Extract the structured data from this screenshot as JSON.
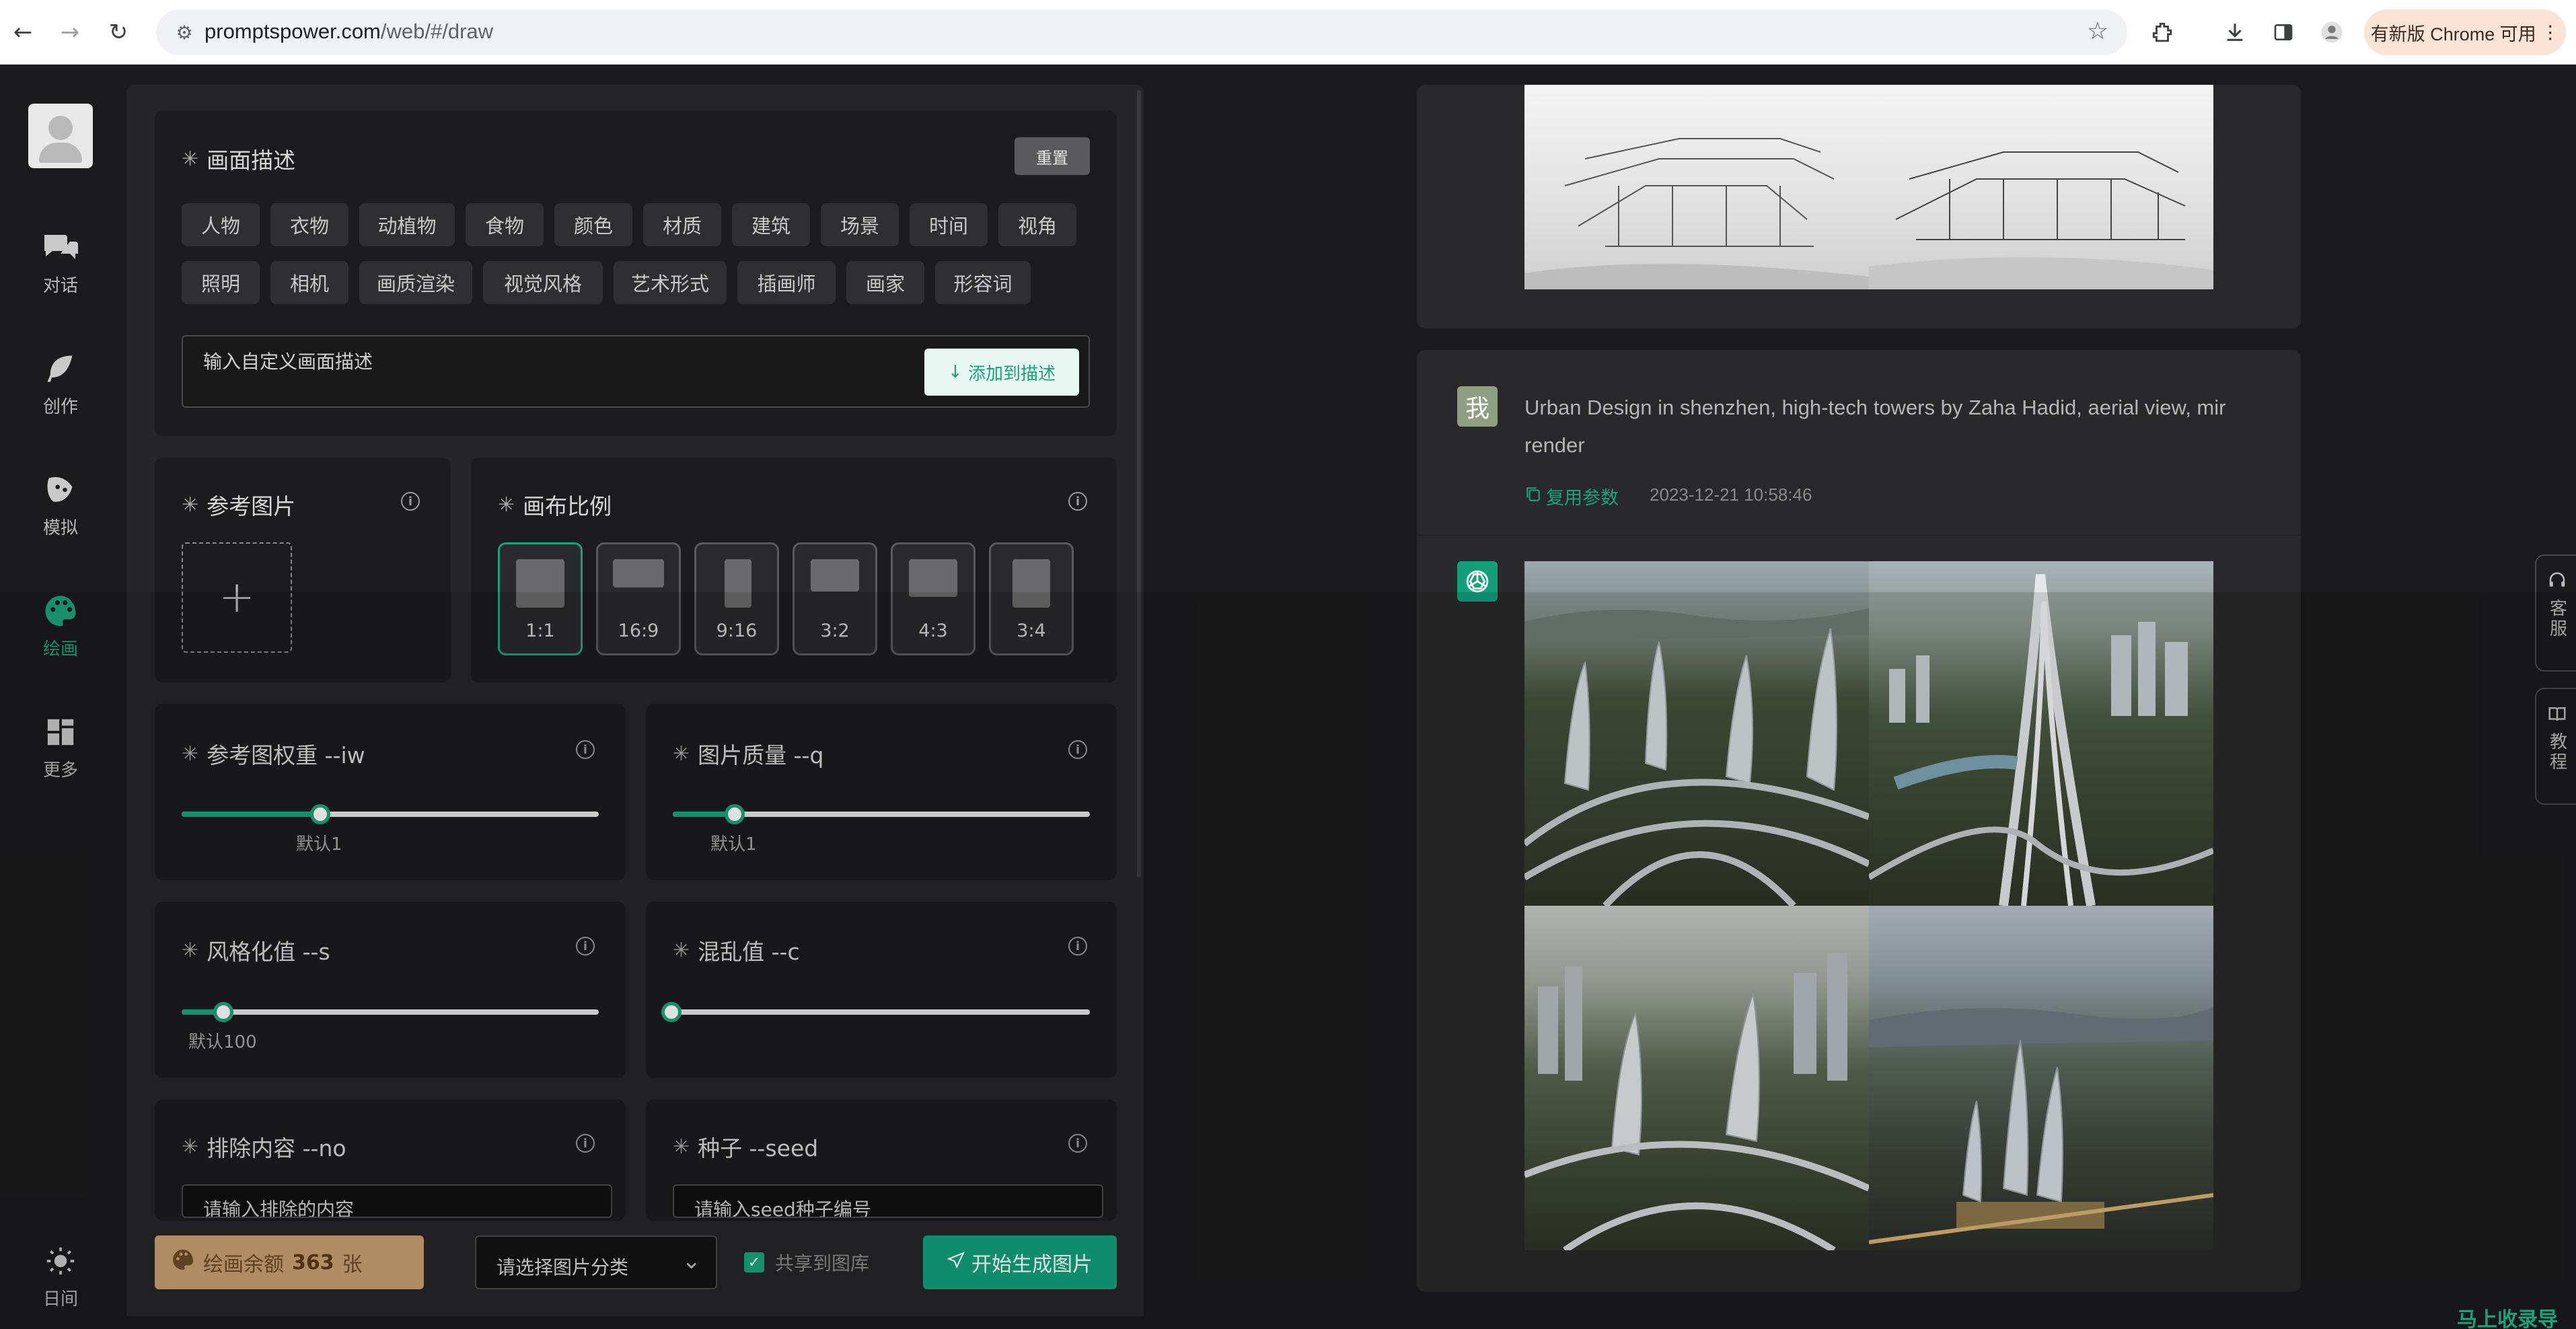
{
  "browser": {
    "url_host": "promptspower.com",
    "url_path": "/web/#/draw",
    "update_label": "有新版 Chrome 可用"
  },
  "sidenav": {
    "items": [
      {
        "label": "对话",
        "icon": "chat-bubbles-icon"
      },
      {
        "label": "创作",
        "icon": "feather-icon"
      },
      {
        "label": "模拟",
        "icon": "mask-icon"
      },
      {
        "label": "绘画",
        "icon": "palette-icon"
      },
      {
        "label": "更多",
        "icon": "grid-icon"
      }
    ],
    "theme_label": "日间"
  },
  "description": {
    "title": "画面描述",
    "reset_label": "重置",
    "chips_row1": [
      "人物",
      "衣物",
      "动植物",
      "食物",
      "颜色",
      "材质",
      "建筑",
      "场景",
      "时间",
      "视角"
    ],
    "chips_row2": [
      "照明",
      "相机",
      "画质渲染",
      "视觉风格",
      "艺术形式",
      "插画师",
      "画家",
      "形容词"
    ],
    "input_placeholder": "输入自定义画面描述",
    "add_label": "添加到描述"
  },
  "reference": {
    "title": "参考图片"
  },
  "ratio": {
    "title": "画布比例",
    "options": [
      "1:1",
      "16:9",
      "9:16",
      "3:2",
      "4:3",
      "3:4"
    ],
    "selected": "1:1"
  },
  "iw": {
    "title": "参考图权重 --iw",
    "note": "默认1",
    "value_fraction": 0.33
  },
  "quality": {
    "title": "图片质量 --q",
    "note": "默认1",
    "value_fraction": 0.15
  },
  "stylize": {
    "title": "风格化值 --s",
    "note": "默认100",
    "value_fraction": 0.1
  },
  "chaos": {
    "title": "混乱值 --c",
    "value_fraction": 0.0
  },
  "no": {
    "title": "排除内容 --no",
    "placeholder": "请输入排除的内容"
  },
  "seed": {
    "title": "种子 --seed",
    "placeholder": "请输入seed种子编号"
  },
  "bottom": {
    "balance_label": "绘画余额",
    "balance_value": "363",
    "balance_unit": "张",
    "category_placeholder": "请选择图片分类",
    "share_label": "共享到图库",
    "generate_label": "开始生成图片"
  },
  "chat": {
    "user_avatar_text": "我",
    "prompt": "Urban Design in shenzhen, high-tech towers by Zaha Hadid, aerial view, mir render",
    "reuse_label": "复用参数",
    "timestamp": "2023-12-21 10:58:46"
  },
  "side_tabs": [
    {
      "label": "客服",
      "icon": "headset-icon"
    },
    {
      "label": "教程",
      "icon": "book-icon"
    }
  ],
  "watermark": "马上收录导航"
}
